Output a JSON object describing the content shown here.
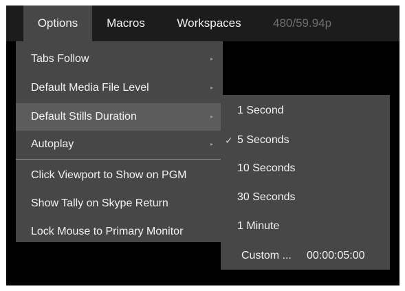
{
  "menubar": {
    "items": [
      {
        "label": "Options",
        "active": true
      },
      {
        "label": "Macros",
        "active": false
      },
      {
        "label": "Workspaces",
        "active": false
      }
    ],
    "status": "480/59.94p"
  },
  "options_menu": {
    "items": [
      {
        "label": "Tabs Follow",
        "has_submenu": true
      },
      {
        "label": "Default Media File Level",
        "has_submenu": true
      },
      {
        "label": "Default Stills Duration",
        "has_submenu": true,
        "highlighted": true
      },
      {
        "label": "Autoplay",
        "has_submenu": true
      },
      {
        "label": "Click Viewport to Show on PGM",
        "has_submenu": false
      },
      {
        "label": "Show Tally on Skype Return",
        "has_submenu": false
      },
      {
        "label": "Lock Mouse to Primary Monitor",
        "has_submenu": false
      }
    ],
    "arrow_glyph": "▸"
  },
  "stills_duration_submenu": {
    "check_glyph": "✓",
    "items": [
      {
        "label": "1 Second",
        "checked": false
      },
      {
        "label": "5 Seconds",
        "checked": true
      },
      {
        "label": "10 Seconds",
        "checked": false
      },
      {
        "label": "30 Seconds",
        "checked": false
      },
      {
        "label": "1 Minute",
        "checked": false
      }
    ],
    "custom": {
      "label": "Custom ...",
      "value": "00:00:05:00"
    }
  },
  "colors": {
    "menubar_bg": "#1c1c1c",
    "menu_bg": "#474747",
    "highlight_bg": "#5c5c5c",
    "status_text": "#6e6e6e",
    "viewport_bg": "#000000"
  }
}
